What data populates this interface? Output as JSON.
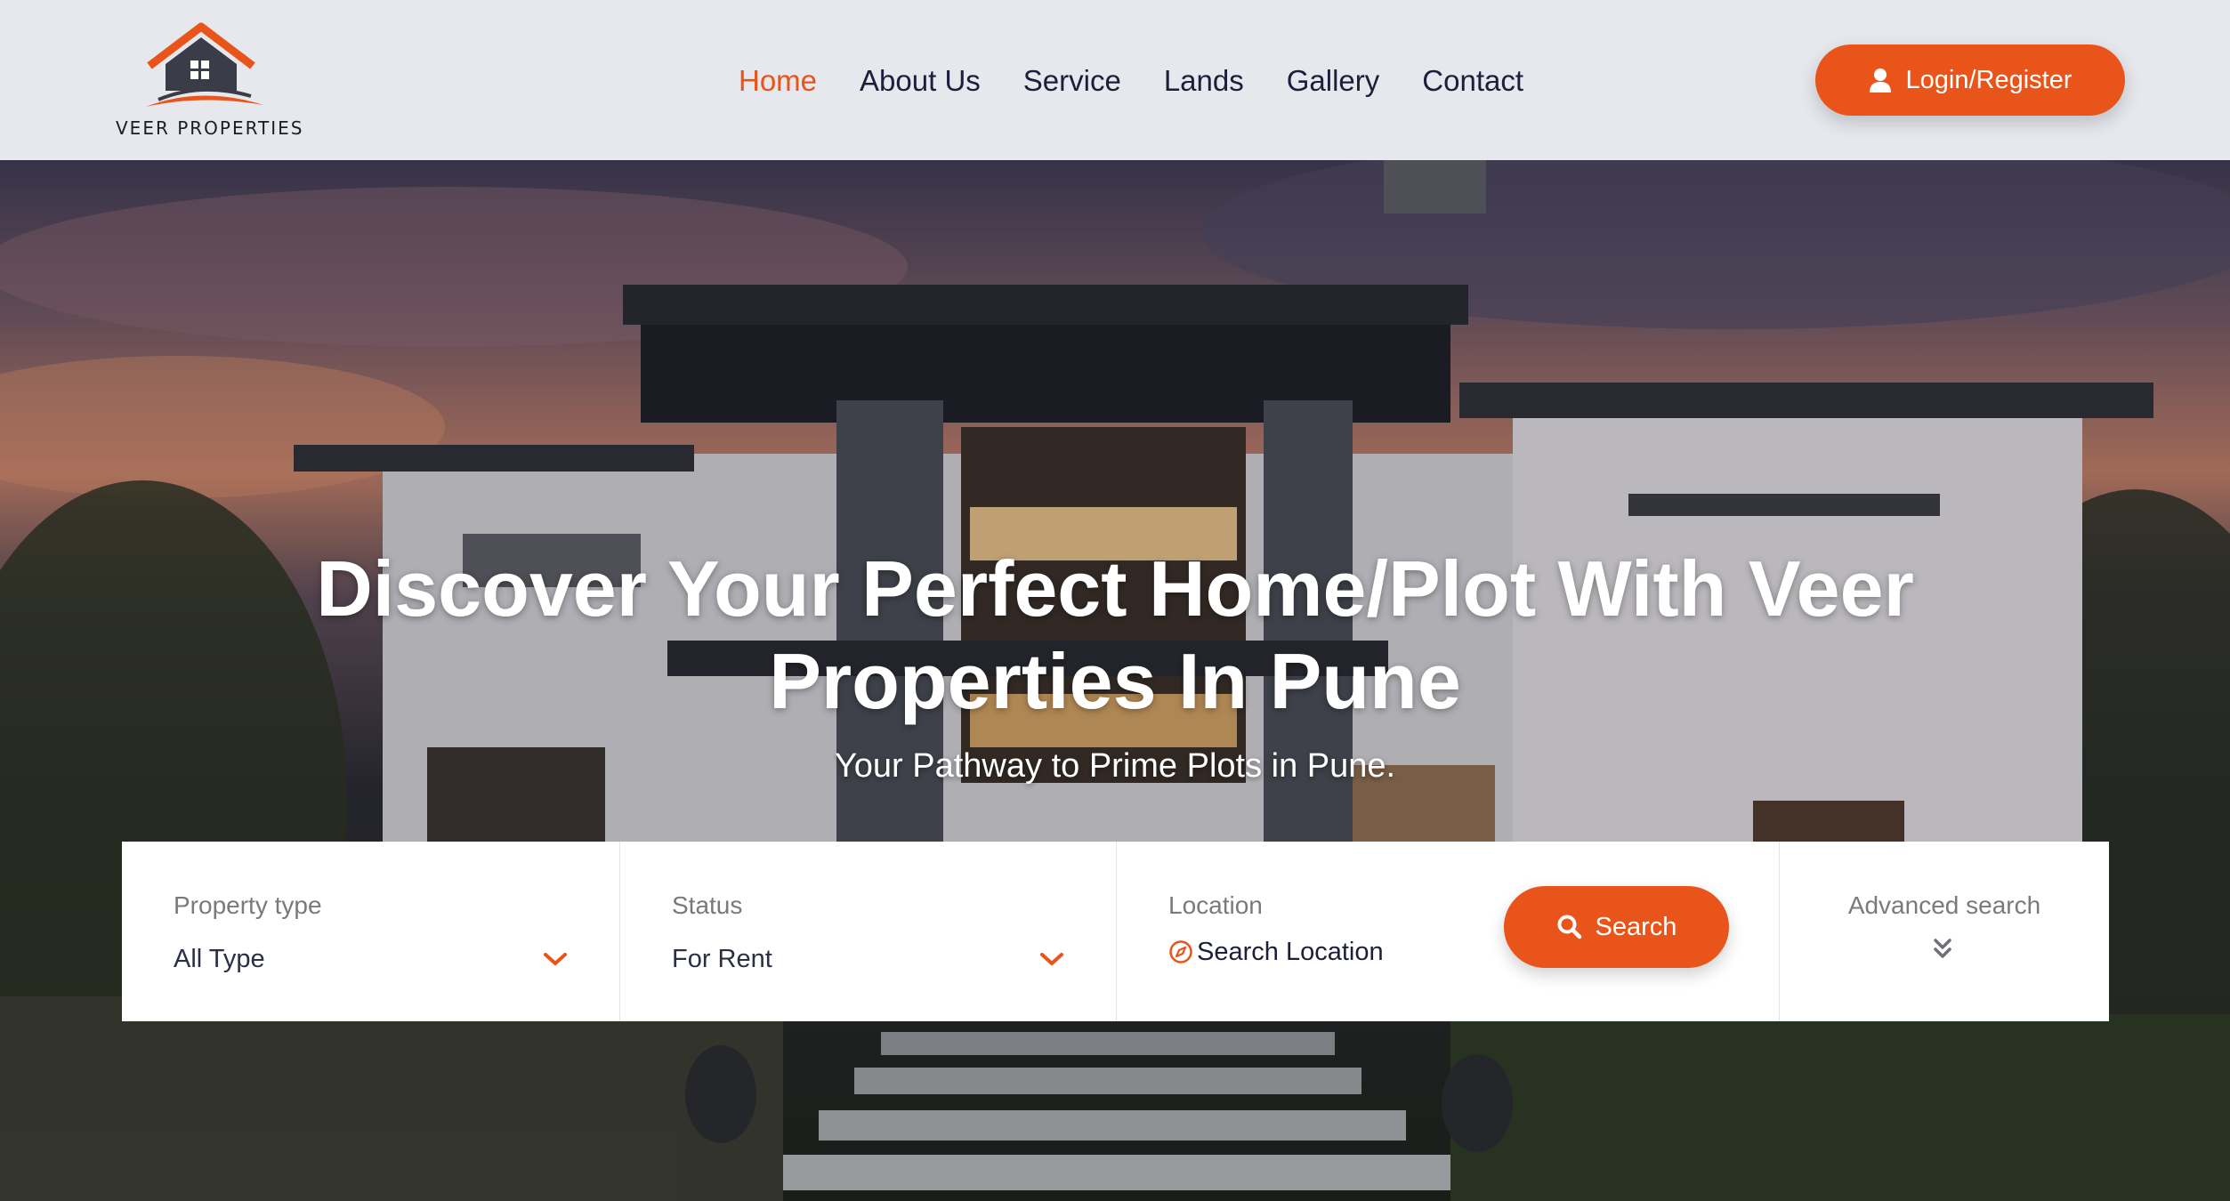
{
  "header": {
    "brand": "VEER PROPERTIES",
    "nav": [
      {
        "label": "Home",
        "active": true
      },
      {
        "label": "About Us",
        "active": false
      },
      {
        "label": "Service",
        "active": false
      },
      {
        "label": "Lands",
        "active": false
      },
      {
        "label": "Gallery",
        "active": false
      },
      {
        "label": "Contact",
        "active": false
      }
    ],
    "login_label": "Login/Register"
  },
  "hero": {
    "title": "Discover Your Perfect Home/Plot With Veer Properties In Pune",
    "subtitle": "Your Pathway to Prime Plots in Pune."
  },
  "search": {
    "property_type": {
      "label": "Property type",
      "value": "All Type"
    },
    "status": {
      "label": "Status",
      "value": "For Rent"
    },
    "location": {
      "label": "Location",
      "placeholder": "Search Location"
    },
    "search_label": "Search",
    "advanced_label": "Advanced search"
  },
  "colors": {
    "accent": "#e8541a",
    "nav_text": "#1c1f3a",
    "header_bg": "#e6e8ed"
  },
  "icons": {
    "login": "user-icon",
    "search": "search-icon",
    "location": "compass-icon",
    "dropdown": "chevron-down-icon",
    "advanced": "double-chevron-down-icon"
  }
}
